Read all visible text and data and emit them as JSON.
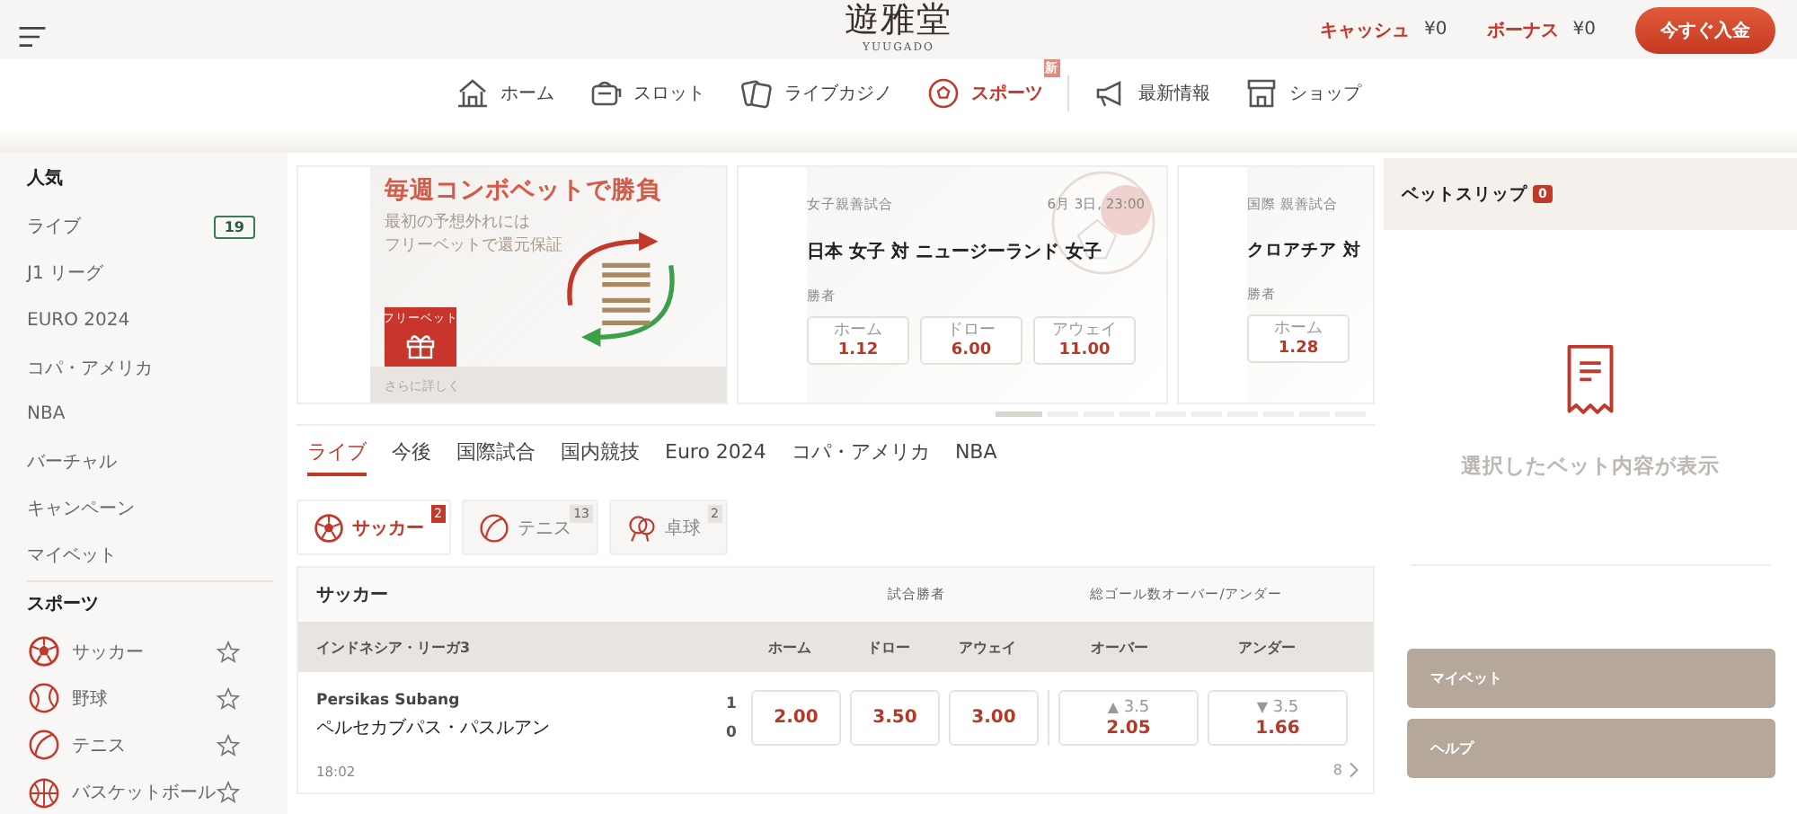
{
  "header": {
    "logo": "遊雅堂",
    "logo_sub": "YUUGADO",
    "wallet": [
      {
        "label": "キャッシュ",
        "value": "¥0"
      },
      {
        "label": "ボーナス",
        "value": "¥0"
      }
    ],
    "deposit_button": "今すぐ入金"
  },
  "nav": [
    {
      "kind": "home",
      "label": "ホーム",
      "selected": false
    },
    {
      "kind": "slot",
      "label": "スロット",
      "selected": false
    },
    {
      "kind": "casino",
      "label": "ライブカジノ",
      "selected": false
    },
    {
      "kind": "sports",
      "label": "スポーツ",
      "selected": true,
      "badge": "新"
    },
    {
      "kind": "news",
      "label": "最新情報",
      "selected": false,
      "divider_before": true
    },
    {
      "kind": "shop",
      "label": "ショップ",
      "selected": false
    }
  ],
  "sidebar": [
    {
      "title": "人気",
      "items": [
        {
          "label": "ライブ",
          "count": "19"
        },
        {
          "label": "J1 リーグ"
        },
        {
          "label": "EURO 2024"
        },
        {
          "label": "コパ・アメリカ"
        },
        {
          "label": "NBA"
        },
        {
          "label": "バーチャル"
        },
        {
          "label": "キャンペーン"
        },
        {
          "label": "マイベット"
        }
      ]
    },
    {
      "title": "スポーツ",
      "items": [
        {
          "kind": "soccer",
          "label": "サッカー",
          "favorite": false
        },
        {
          "kind": "baseball",
          "label": "野球",
          "favorite": false
        },
        {
          "kind": "tennis",
          "label": "テニス",
          "favorite": false
        },
        {
          "kind": "basketball",
          "label": "バスケットボール",
          "favorite": false
        }
      ]
    }
  ],
  "promo": {
    "title": "毎週コンボベットで勝負",
    "lines": [
      "最初の予想外れには",
      "フリーベットで還元保証"
    ],
    "badge": "フリーベット",
    "link": "さらに詳しく"
  },
  "featured": [
    {
      "competition": "女子親善試合",
      "date": "6月 3日, 23:00",
      "match": "日本 女子 対 ニュージーランド 女子",
      "market": "勝者",
      "odds": [
        {
          "label": "ホーム",
          "value": "1.12"
        },
        {
          "label": "ドロー",
          "value": "6.00"
        },
        {
          "label": "アウェイ",
          "value": "11.00"
        }
      ]
    },
    {
      "competition": "国際 親善試合",
      "match": "クロアチア 対",
      "market": "勝者",
      "odds": [
        {
          "label": "ホーム",
          "value": "1.28"
        }
      ]
    }
  ],
  "pager": [
    {
      "selected": true
    },
    {
      "selected": false
    },
    {
      "selected": false
    },
    {
      "selected": false
    },
    {
      "selected": false
    },
    {
      "selected": false
    },
    {
      "selected": false
    },
    {
      "selected": false
    },
    {
      "selected": false
    },
    {
      "selected": false
    }
  ],
  "tabs": [
    {
      "label": "ライブ",
      "selected": true
    },
    {
      "label": "今後",
      "selected": false
    },
    {
      "label": "国際試合",
      "selected": false
    },
    {
      "label": "国内競技",
      "selected": false
    },
    {
      "label": "Euro 2024",
      "selected": false
    },
    {
      "label": "コパ・アメリカ",
      "selected": false
    },
    {
      "label": "NBA",
      "selected": false
    }
  ],
  "sports": [
    {
      "kind": "soccer",
      "label": "サッカー",
      "count": "2",
      "selected": true
    },
    {
      "kind": "tennis",
      "label": "テニス",
      "count": "13",
      "selected": false
    },
    {
      "kind": "pingpong",
      "label": "卓球",
      "count": "2",
      "selected": false
    }
  ],
  "table": {
    "title": "サッカー",
    "groups": [
      "試合勝者",
      "総ゴール数オーバー/アンダー"
    ],
    "league": "インドネシア・リーガ3",
    "columns": [
      "ホーム",
      "ドロー",
      "アウェイ",
      "オーバー",
      "アンダー"
    ],
    "matches": [
      {
        "home": "Persikas Subang",
        "away": "ペルセカブパス・パスルアン",
        "score_home": "1",
        "score_away": "0",
        "time": "18:02",
        "more": "8",
        "odds": [
          {
            "value": "2.00"
          },
          {
            "value": "3.50"
          },
          {
            "value": "3.00"
          },
          {
            "arrow": "▲",
            "line": "3.5",
            "value": "2.05"
          },
          {
            "arrow": "▼",
            "line": "3.5",
            "value": "1.66"
          }
        ]
      }
    ]
  },
  "betslip": {
    "title": "ベットスリップ",
    "count": "0",
    "empty_text": "選択したベット内容が表示",
    "buttons": [
      "マイベット",
      "ヘルプ"
    ]
  }
}
